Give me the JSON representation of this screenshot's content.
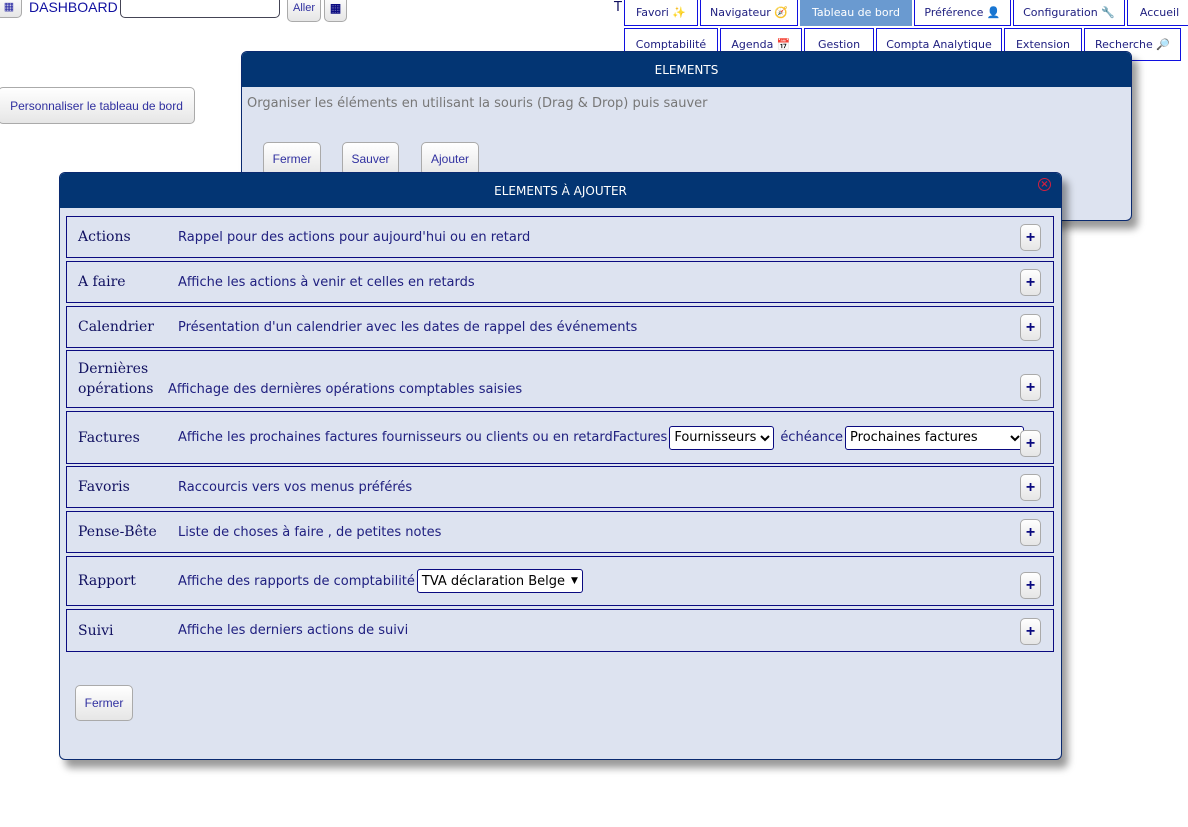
{
  "topbar": {
    "title": "DASHBOARD",
    "search_value": "",
    "go_label": "Aller",
    "truncated": "T"
  },
  "nav_row1": [
    {
      "label": "Favori ✨"
    },
    {
      "label": "Navigateur 🧭"
    },
    {
      "label": "Tableau de bord",
      "active": true
    },
    {
      "label": "Préférence 👤"
    },
    {
      "label": "Configuration 🔧"
    },
    {
      "label": "Accueil"
    }
  ],
  "nav_row2": [
    {
      "label": "Comptabilité"
    },
    {
      "label": "Agenda 📅"
    },
    {
      "label": "Gestion"
    },
    {
      "label": "Compta Analytique"
    },
    {
      "label": "Extension"
    },
    {
      "label": "Recherche 🔎"
    }
  ],
  "customize_label": "Personnaliser le tableau de bord",
  "elements_dialog": {
    "title": "ELEMENTS",
    "instructions": "Organiser les éléments en utilisant la souris (Drag & Drop) puis sauver",
    "buttons": [
      "Fermer",
      "Sauver",
      "Ajouter"
    ]
  },
  "add_dialog": {
    "title": "ELEMENTS À AJOUTER",
    "close_label": "Fermer",
    "rows": [
      {
        "name": "Actions",
        "desc": "Rappel pour des actions pour aujourd'hui ou en retard"
      },
      {
        "name": "A faire",
        "desc": "Affiche les actions à venir et celles en retards"
      },
      {
        "name": "Calendrier",
        "desc": "Présentation d'un calendrier avec les dates de rappel des événements"
      },
      {
        "name": "Dernières opérations",
        "desc": "Affichage des dernières opérations comptables saisies"
      },
      {
        "name": "Factures",
        "desc": "Affiche les prochaines factures fournisseurs ou clients ou en retardFactures",
        "select1": "Fournisseurs",
        "mid": "échéance",
        "select2": "Prochaines factures"
      },
      {
        "name": "Favoris",
        "desc": "Raccourcis vers vos menus préférés"
      },
      {
        "name": "Pense-Bête",
        "desc": "Liste de choses à faire , de petites notes"
      },
      {
        "name": "Rapport",
        "desc": "Affiche des rapports de comptabilité",
        "select1": "TVA déclaration Belge"
      },
      {
        "name": "Suivi",
        "desc": "Affiche les derniers actions de suivi"
      }
    ]
  },
  "colors": {
    "header": "#033573",
    "dialog_bg": "#dde3f0",
    "active_tab": "#6a9ad0"
  }
}
